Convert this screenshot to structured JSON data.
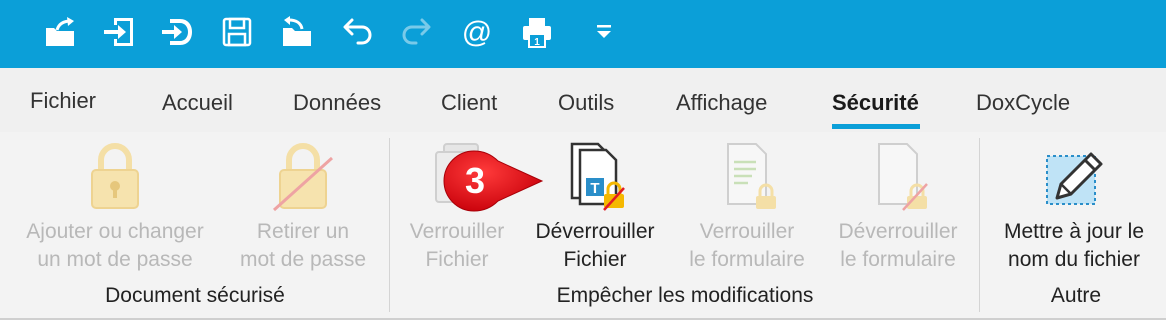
{
  "quick_access": {
    "items": [
      {
        "icon": "export-icon",
        "disabled": false
      },
      {
        "icon": "import-icon",
        "disabled": false
      },
      {
        "icon": "checkin-icon",
        "disabled": false
      },
      {
        "icon": "save-icon",
        "disabled": false
      },
      {
        "icon": "folder-back-icon",
        "disabled": false
      },
      {
        "icon": "undo-icon",
        "disabled": false
      },
      {
        "icon": "redo-icon",
        "disabled": true
      },
      {
        "icon": "at-sign-icon",
        "disabled": false
      },
      {
        "icon": "printer-icon",
        "disabled": false
      },
      {
        "icon": "customize-dropdown-icon",
        "disabled": false
      }
    ],
    "at_symbol": "@",
    "printer_badge": "1"
  },
  "tabs": [
    {
      "label": "Fichier",
      "active": false
    },
    {
      "label": "Accueil",
      "active": false
    },
    {
      "label": "Données",
      "active": false
    },
    {
      "label": "Client",
      "active": false
    },
    {
      "label": "Outils",
      "active": false
    },
    {
      "label": "Affichage",
      "active": false
    },
    {
      "label": "Sécurité",
      "active": true
    },
    {
      "label": "DoxCycle",
      "active": false
    }
  ],
  "ribbon": {
    "groups": [
      {
        "label": "Document sécurisé",
        "buttons": [
          {
            "line1": "Ajouter ou changer",
            "line2": "un mot de passe",
            "icon": "padlock-icon",
            "disabled": true
          },
          {
            "line1": "Retirer un",
            "line2": "mot de passe",
            "icon": "padlock-remove-icon",
            "disabled": true
          }
        ]
      },
      {
        "label": "Empêcher les modifications",
        "buttons": [
          {
            "line1": "Verrouiller",
            "line2": "Fichier",
            "icon": "lock-file-icon",
            "disabled": true
          },
          {
            "line1": "Déverrouiller",
            "line2": "Fichier",
            "icon": "unlock-file-icon",
            "disabled": false
          },
          {
            "line1": "Verrouiller",
            "line2": "le formulaire",
            "icon": "lock-form-icon",
            "disabled": true
          },
          {
            "line1": "Déverrouiller",
            "line2": "le formulaire",
            "icon": "unlock-form-icon",
            "disabled": true
          }
        ]
      },
      {
        "label": "Autre",
        "buttons": [
          {
            "line1": "Mettre à jour le",
            "line2": "nom du fichier",
            "icon": "pencil-icon",
            "disabled": false
          }
        ]
      }
    ]
  },
  "step_badge": {
    "number": "3",
    "color": "#e0141e"
  },
  "colors": {
    "accent": "#0b9fd8",
    "lock_gold": "#f5b800",
    "disabled_gold": "#f4dfa6",
    "strike_red": "#e21b23"
  }
}
